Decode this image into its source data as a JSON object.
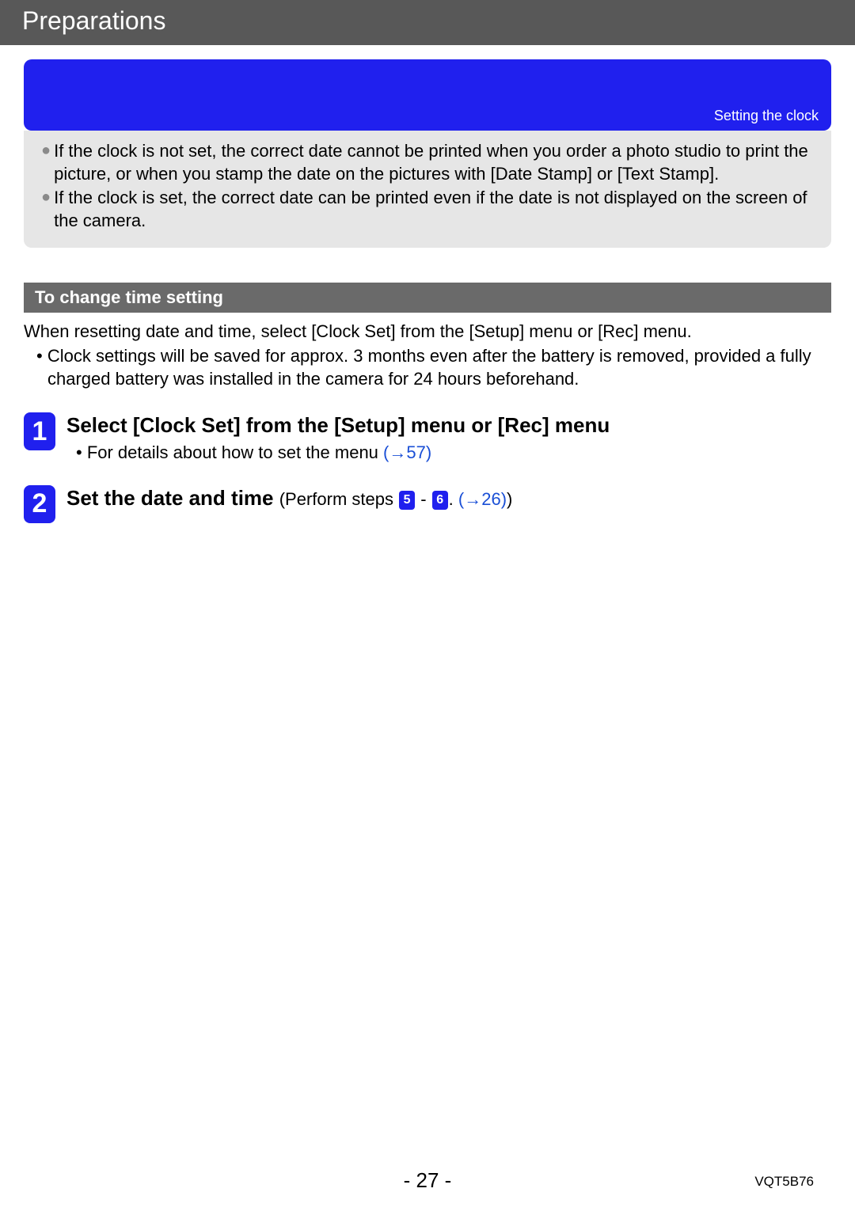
{
  "header": {
    "title": "Preparations"
  },
  "banner": {
    "label": "Setting the clock"
  },
  "notes": {
    "b1": "If the clock is not set, the correct date cannot be printed when you order a photo studio to print the picture, or when you stamp the date on the pictures with [Date Stamp] or [Text Stamp].",
    "b2": "If the clock is set, the correct date can be printed even if the date is not displayed on the screen of the camera."
  },
  "section": {
    "title": "To change time setting"
  },
  "intro": {
    "line1": "When resetting date and time, select [Clock Set] from the [Setup] menu or [Rec] menu.",
    "line2": "Clock settings will be saved for approx. 3 months even after the battery is removed, provided a fully charged battery was installed in the camera for 24 hours beforehand."
  },
  "steps": {
    "s1": {
      "num": "1",
      "title": "Select [Clock Set] from the [Setup] menu or [Rec] menu",
      "detail_prefix": "• For details about how to set the menu ",
      "detail_link": "(→57)"
    },
    "s2": {
      "num": "2",
      "title_a": "Set the date and time ",
      "title_b": "(Perform steps ",
      "badge_a": "5",
      "dash": " - ",
      "badge_b": "6",
      "title_c": ". ",
      "link": "(→26)",
      "title_d": ")"
    }
  },
  "footer": {
    "page": "- 27 -",
    "code": "VQT5B76"
  }
}
